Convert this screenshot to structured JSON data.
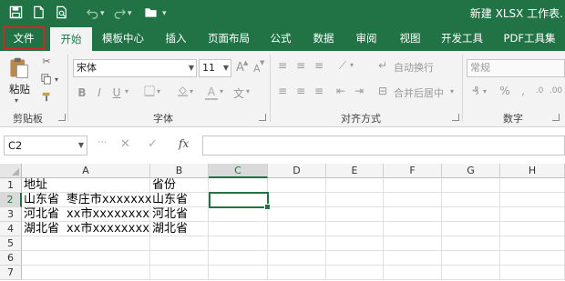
{
  "quick_access": {
    "icons": [
      "save-icon",
      "new-file-icon",
      "print-preview-icon",
      "undo-icon",
      "redo-icon",
      "open-folder-icon"
    ]
  },
  "document": {
    "title": "新建 XLSX 工作表."
  },
  "tabs": [
    {
      "label": "文件"
    },
    {
      "label": "开始"
    },
    {
      "label": "模板中心"
    },
    {
      "label": "插入"
    },
    {
      "label": "页面布局"
    },
    {
      "label": "公式"
    },
    {
      "label": "数据"
    },
    {
      "label": "审阅"
    },
    {
      "label": "视图"
    },
    {
      "label": "开发工具"
    },
    {
      "label": "PDF工具集"
    }
  ],
  "ribbon": {
    "clipboard": {
      "paste_label": "粘贴",
      "group_label": "剪贴板"
    },
    "font": {
      "font_name": "宋体",
      "font_size": "11",
      "grow": "A",
      "shrink": "A",
      "group_label": "字体",
      "wen": "文"
    },
    "alignment": {
      "wrap_text": "自动换行",
      "merge_center": "合并后居中",
      "group_label": "对齐方式"
    },
    "number": {
      "format": "常规",
      "group_label": "数字"
    }
  },
  "formula_bar": {
    "name_box": "C2",
    "fx": "fx",
    "value": ""
  },
  "sheet": {
    "columns": [
      "A",
      "B",
      "C",
      "D",
      "E",
      "F",
      "G",
      "H"
    ],
    "rows": [
      "1",
      "2",
      "3",
      "4",
      "5",
      "6",
      "7"
    ],
    "selected_cell": "C2",
    "cells": {
      "A1": "地址",
      "B1": "省份",
      "A2": "山东省 枣庄市xxxxxxx",
      "B2": "山东省",
      "A3": "河北省 xx市xxxxxxxx",
      "B3": "河北省",
      "A4": "湖北省 xx市xxxxxxxx",
      "B4": "湖北省"
    }
  },
  "colors": {
    "accent": "#217346",
    "file_highlight": "#e02020"
  }
}
